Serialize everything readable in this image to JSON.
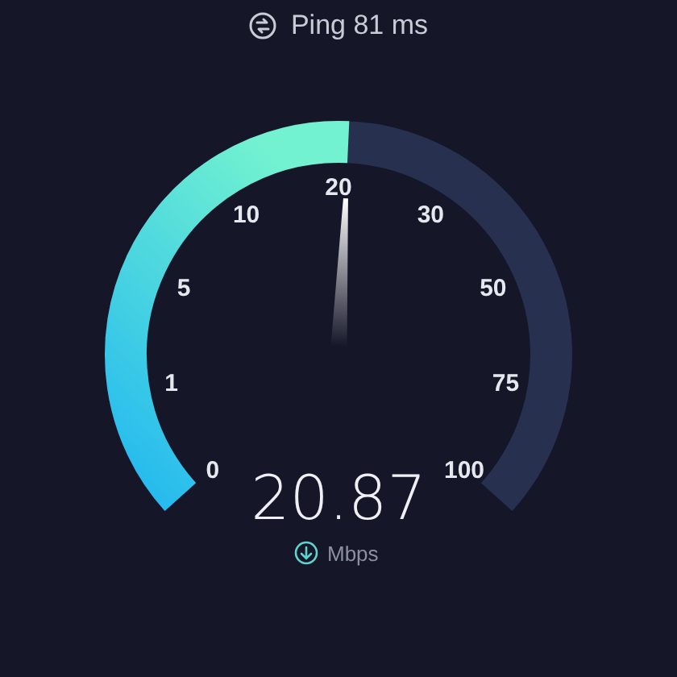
{
  "ping": {
    "text": "Ping 81 ms"
  },
  "gauge": {
    "scale": [
      "0",
      "1",
      "5",
      "10",
      "20",
      "30",
      "50",
      "75",
      "100"
    ]
  },
  "reading": {
    "value": "20.87",
    "unit": "Mbps"
  }
}
